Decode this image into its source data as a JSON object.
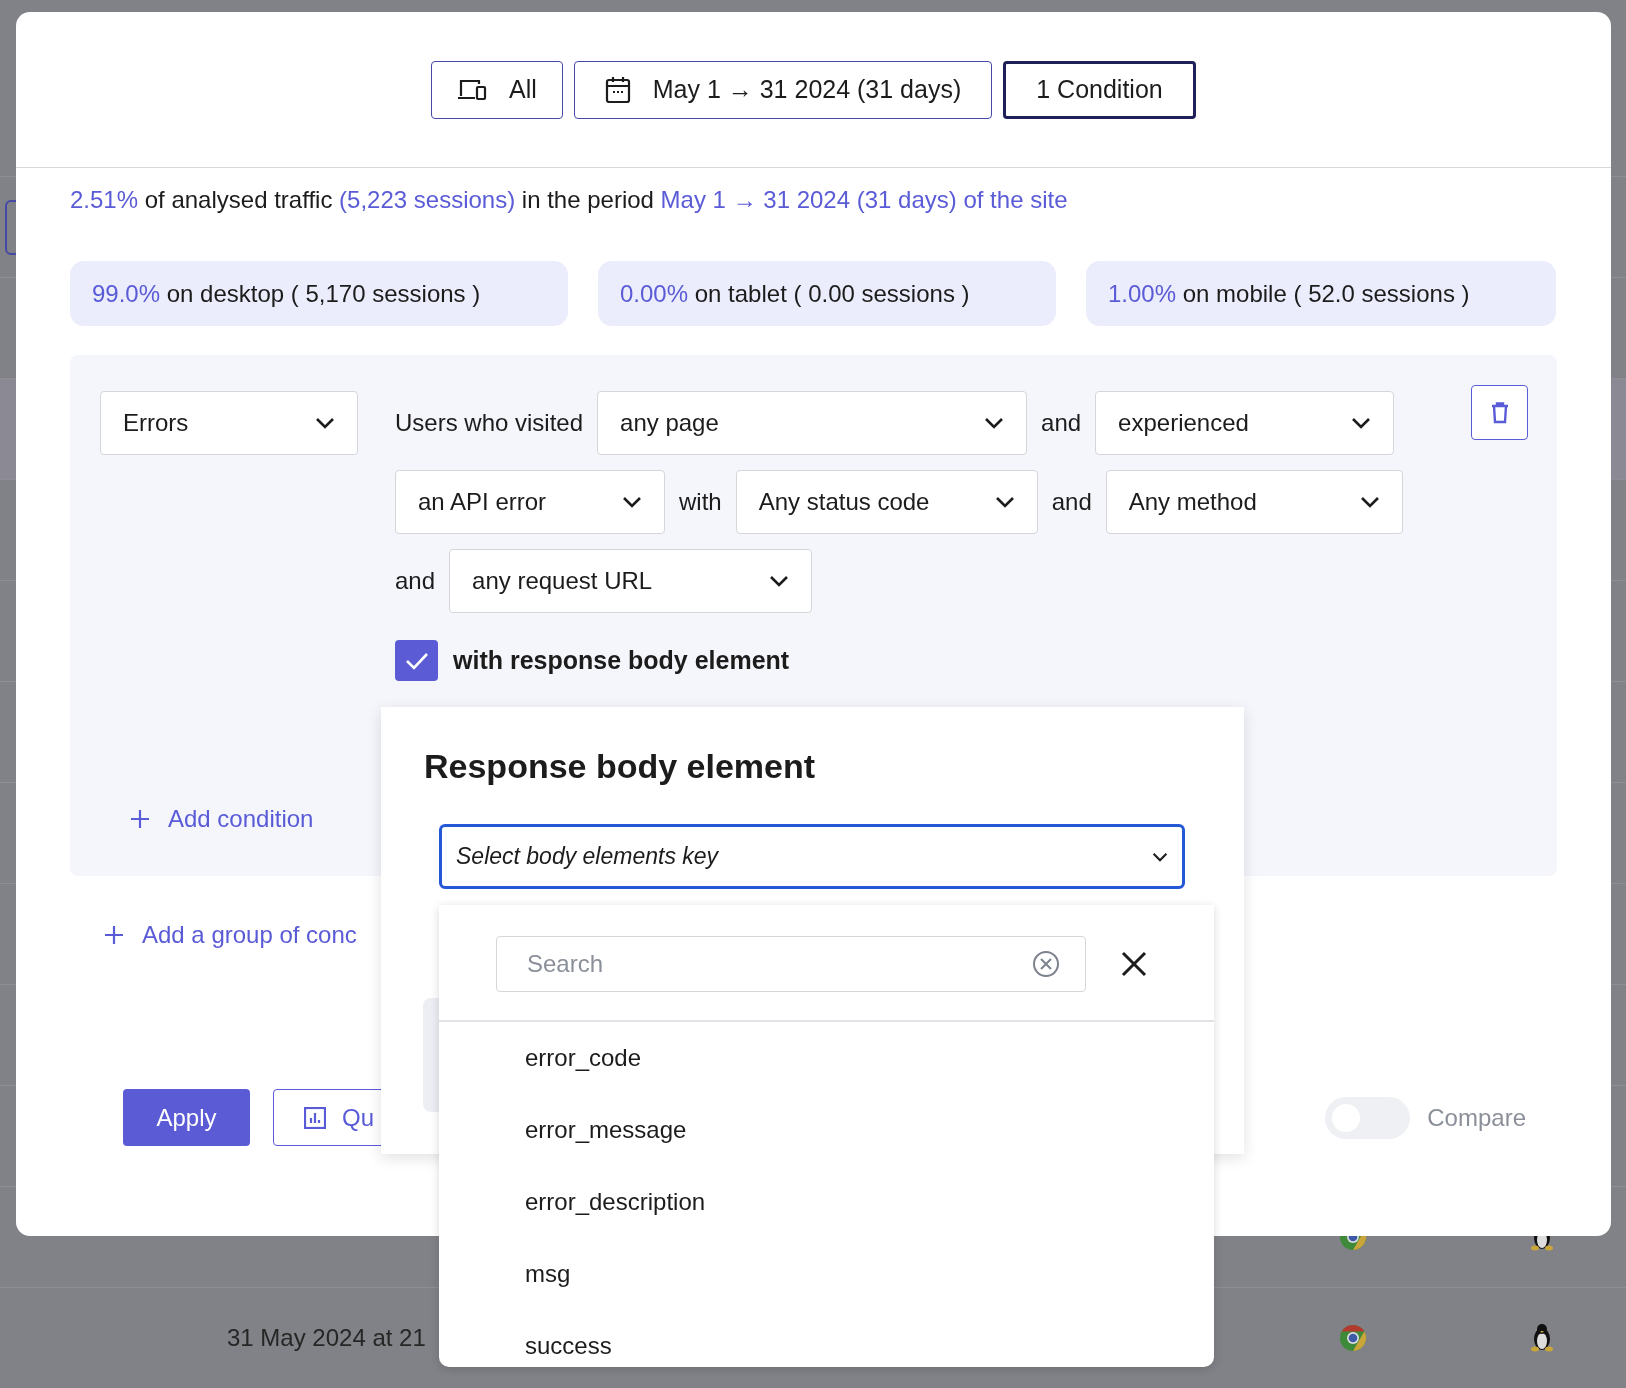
{
  "background_table": {
    "rows": [
      {
        "selected": false
      },
      {
        "selected": true
      },
      {
        "selected": false
      },
      {
        "selected": false
      },
      {
        "selected": false
      },
      {
        "selected": false
      },
      {
        "selected": false
      },
      {
        "selected": false
      },
      {
        "selected": false
      },
      {
        "selected": false
      },
      {
        "date": "31 May 2024 at 21",
        "selected": false
      }
    ]
  },
  "filters": [
    {
      "kind": "devices",
      "label": "All",
      "selected": false
    },
    {
      "kind": "date",
      "label": "May 1 → 31 2024 (31 days)",
      "selected": false
    },
    {
      "kind": "conditions",
      "label": "1 Condition",
      "selected": true
    }
  ],
  "summary": [
    {
      "text": "2.51%",
      "highlight": true
    },
    {
      "text": "of analysed traffic",
      "highlight": false
    },
    {
      "text": "(5,223 sessions)",
      "highlight": true
    },
    {
      "text": "in the period",
      "highlight": false
    },
    {
      "text": "May 1 → 31 2024 (31 days) of the site",
      "highlight": true
    }
  ],
  "device_stats": [
    {
      "percent": "99.0%",
      "label": "on desktop ( 5,170 sessions )"
    },
    {
      "percent": "0.00%",
      "label": "on tablet ( 0.00 sessions )"
    },
    {
      "percent": "1.00%",
      "label": "on mobile ( 52.0 sessions )"
    }
  ],
  "condition_group": {
    "category": "Errors",
    "sentence_lines": [
      [
        {
          "kind": "text",
          "text": "Users who visited"
        },
        {
          "kind": "select",
          "value": "any page"
        },
        {
          "kind": "text",
          "text": "and"
        },
        {
          "kind": "select",
          "value": "experienced"
        }
      ],
      [
        {
          "kind": "select",
          "value": "an API error"
        },
        {
          "kind": "text",
          "text": "with"
        },
        {
          "kind": "select",
          "value": "Any status code"
        },
        {
          "kind": "text",
          "text": "and"
        },
        {
          "kind": "select",
          "value": "Any method"
        }
      ],
      [
        {
          "kind": "text",
          "text": "and"
        },
        {
          "kind": "select",
          "value": "any request URL"
        }
      ]
    ],
    "checkbox": {
      "label": "with response body element",
      "checked": true
    },
    "add_condition": "Add condition"
  },
  "add_group": "Add a group of conc",
  "footer": {
    "apply": "Apply",
    "secondary": "Qu",
    "compare": {
      "label": "Compare",
      "on": false
    }
  },
  "popover": {
    "title": "Response body element",
    "select": {
      "placeholder": "Select body elements key"
    },
    "dropdown": {
      "search": {
        "placeholder": "Search"
      },
      "options": [
        "error_code",
        "error_message",
        "error_description",
        "msg",
        "success"
      ]
    }
  }
}
